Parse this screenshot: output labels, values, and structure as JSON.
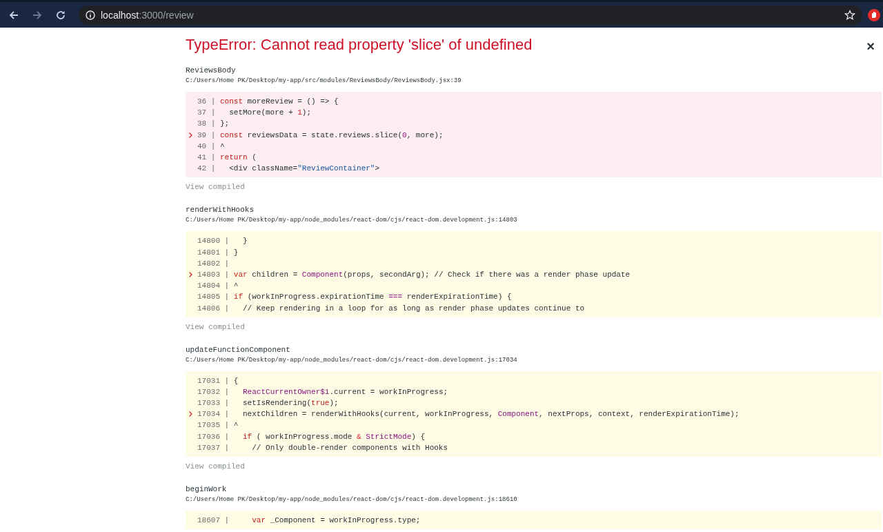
{
  "browser": {
    "url_host": "localhost",
    "url_path": ":3000/review"
  },
  "error": {
    "title": "TypeError: Cannot read property 'slice' of undefined",
    "close": "×"
  },
  "frames": [
    {
      "function": "ReviewsBody",
      "path": "C:/Users/Home PK/Desktop/my-app/src/modules/ReviewsBody/ReviewsBody.jsx:39",
      "kind": "app",
      "link": "View compiled",
      "lines": [
        {
          "gutter": "36 |",
          "current": false,
          "tokens": [
            {
              "text": " const",
              "kind": "keyword"
            },
            {
              "text": " moreReview = () => {",
              "kind": "plain"
            }
          ]
        },
        {
          "gutter": "37 |",
          "current": false,
          "tokens": [
            {
              "text": "   setMore(more + ",
              "kind": "plain"
            },
            {
              "text": "1",
              "kind": "number"
            },
            {
              "text": ");",
              "kind": "plain"
            }
          ]
        },
        {
          "gutter": "38 |",
          "current": false,
          "tokens": [
            {
              "text": " };",
              "kind": "plain"
            }
          ]
        },
        {
          "gutter": "39 |",
          "current": true,
          "tokens": [
            {
              "text": " const",
              "kind": "keyword"
            },
            {
              "text": " reviewsData = state.reviews.slice(",
              "kind": "plain"
            },
            {
              "text": "0",
              "kind": "name"
            },
            {
              "text": ", more);",
              "kind": "plain"
            }
          ]
        },
        {
          "gutter": "40 |",
          "current": false,
          "tokens": [
            {
              "text": " ^",
              "kind": "plain"
            }
          ]
        },
        {
          "gutter": "41 |",
          "current": false,
          "tokens": [
            {
              "text": " return",
              "kind": "keyword"
            },
            {
              "text": " (",
              "kind": "plain"
            }
          ]
        },
        {
          "gutter": "42 |",
          "current": false,
          "tokens": [
            {
              "text": "   <div className=",
              "kind": "plain"
            },
            {
              "text": "\"ReviewContainer\"",
              "kind": "string"
            },
            {
              "text": ">",
              "kind": "plain"
            }
          ]
        }
      ]
    },
    {
      "function": "renderWithHooks",
      "path": "C:/Users/Home PK/Desktop/my-app/node_modules/react-dom/cjs/react-dom.development.js:14803",
      "kind": "library",
      "link": "View compiled",
      "lines": [
        {
          "gutter": "14800 |",
          "current": false,
          "tokens": [
            {
              "text": "   }",
              "kind": "plain"
            }
          ]
        },
        {
          "gutter": "14801 |",
          "current": false,
          "tokens": [
            {
              "text": " }",
              "kind": "plain"
            }
          ]
        },
        {
          "gutter": "14802 |",
          "current": false
        },
        {
          "gutter": "14803 |",
          "current": true,
          "tokens": [
            {
              "text": " var",
              "kind": "keyword"
            },
            {
              "text": " children = ",
              "kind": "plain"
            },
            {
              "text": "Component",
              "kind": "name"
            },
            {
              "text": "(props, secondArg); // Check if there was a render phase update",
              "kind": "plain"
            }
          ]
        },
        {
          "gutter": "14804 |",
          "current": false,
          "tokens": [
            {
              "text": " ^",
              "kind": "plain"
            }
          ]
        },
        {
          "gutter": "14805 |",
          "current": false,
          "tokens": [
            {
              "text": " if",
              "kind": "keyword"
            },
            {
              "text": " (workInProgress.expirationTime ",
              "kind": "plain"
            },
            {
              "text": "===",
              "kind": "name"
            },
            {
              "text": " renderExpirationTime) {",
              "kind": "plain"
            }
          ]
        },
        {
          "gutter": "14806 |",
          "current": false,
          "tokens": [
            {
              "text": "   // Keep rendering in a loop for as long as render phase updates continue to",
              "kind": "plain"
            }
          ]
        }
      ]
    },
    {
      "function": "updateFunctionComponent",
      "path": "C:/Users/Home PK/Desktop/my-app/node_modules/react-dom/cjs/react-dom.development.js:17034",
      "kind": "library",
      "link": "View compiled",
      "lines": [
        {
          "gutter": "17031 |",
          "current": false,
          "tokens": [
            {
              "text": " {",
              "kind": "plain"
            }
          ]
        },
        {
          "gutter": "17032 |",
          "current": false,
          "tokens": [
            {
              "text": "   ReactCurrentOwner$1",
              "kind": "name"
            },
            {
              "text": ".current = workInProgress;",
              "kind": "plain"
            }
          ]
        },
        {
          "gutter": "17033 |",
          "current": false,
          "tokens": [
            {
              "text": "   setIsRendering(",
              "kind": "plain"
            },
            {
              "text": "true",
              "kind": "keyword"
            },
            {
              "text": ");",
              "kind": "plain"
            }
          ]
        },
        {
          "gutter": "17034 |",
          "current": true,
          "tokens": [
            {
              "text": "   nextChildren = renderWithHooks(current, workInProgress, ",
              "kind": "plain"
            },
            {
              "text": "Component",
              "kind": "name"
            },
            {
              "text": ", nextProps, context, renderExpirationTime);",
              "kind": "plain"
            }
          ]
        },
        {
          "gutter": "17035 |",
          "current": false,
          "tokens": [
            {
              "text": " ^",
              "kind": "plain"
            }
          ]
        },
        {
          "gutter": "17036 |",
          "current": false,
          "tokens": [
            {
              "text": "   if",
              "kind": "keyword"
            },
            {
              "text": " ( workInProgress.mode ",
              "kind": "plain"
            },
            {
              "text": "&",
              "kind": "keyword"
            },
            {
              "text": " StrictMode",
              "kind": "name"
            },
            {
              "text": ") {",
              "kind": "plain"
            }
          ]
        },
        {
          "gutter": "17037 |",
          "current": false,
          "tokens": [
            {
              "text": "     // Only double-render components with Hooks",
              "kind": "plain"
            }
          ]
        }
      ]
    },
    {
      "function": "beginWork",
      "path": "C:/Users/Home PK/Desktop/my-app/node_modules/react-dom/cjs/react-dom.development.js:18610",
      "kind": "library",
      "lines": [
        {
          "gutter": "18607 |",
          "current": false,
          "tokens": [
            {
              "text": "     var",
              "kind": "keyword"
            },
            {
              "text": " _Component = workInProgress.type;",
              "kind": "plain"
            }
          ]
        }
      ]
    }
  ]
}
